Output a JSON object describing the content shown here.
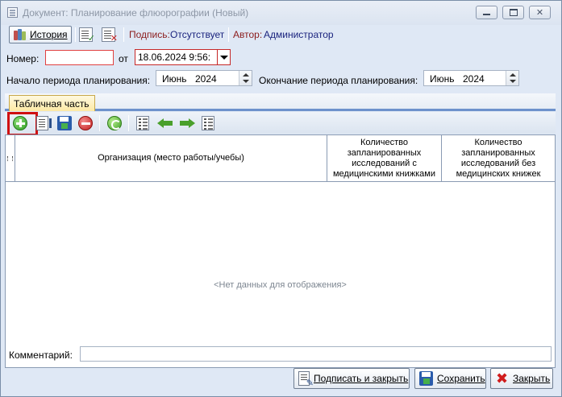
{
  "window": {
    "title": "Документ: Планирование флюорографии (Новый)"
  },
  "toolbar": {
    "history_label": "История",
    "signature_label": "Подпись:",
    "signature_value": "Отсутствует",
    "author_label": "Автор:",
    "author_value": "Администратор"
  },
  "header": {
    "number_label": "Номер:",
    "number_value": "",
    "date_from_label": "от",
    "date_value": "18.06.2024 9:56:",
    "period_start_label": "Начало периода планирования:",
    "period_start_month": "Июнь",
    "period_start_year": "2024",
    "period_end_label": "Окончание периода планирования:",
    "period_end_month": "Июнь",
    "period_end_year": "2024"
  },
  "tab": {
    "label": "Табличная часть"
  },
  "grid": {
    "columns": [
      "Организация (место работы/учебы)",
      "Количество запланированных исследований с медицинскими книжками",
      "Количество запланированных исследований без медицинских книжек"
    ],
    "rows": [],
    "empty_text": "<Нет данных для отображения>"
  },
  "comment": {
    "label": "Комментарий:",
    "value": ""
  },
  "buttons": {
    "sign_close": "Подписать и закрыть",
    "save": "Сохранить",
    "close": "Закрыть"
  },
  "icons": {
    "history": "books-icon",
    "sign": "document-sign-icon",
    "unsign": "document-unsign-icon",
    "add": "add-icon",
    "edit": "edit-icon",
    "save": "save-icon",
    "delete": "delete-icon",
    "refresh": "refresh-icon",
    "move_left": "arrow-left-icon",
    "move_right": "arrow-right-icon",
    "close": "close-icon"
  },
  "colors": {
    "required_border": "#e04040",
    "highlight_frame": "#d01010",
    "label_red": "#8b1c1c",
    "value_blue": "#1a237e",
    "tab_fill": "#fde9a4"
  }
}
